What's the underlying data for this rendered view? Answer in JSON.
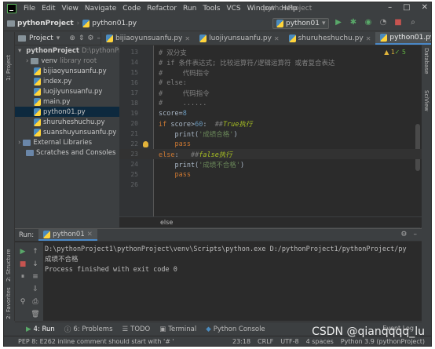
{
  "menubar": {
    "items": [
      "File",
      "Edit",
      "View",
      "Navigate",
      "Code",
      "Refactor",
      "Run",
      "Tools",
      "VCS",
      "Window",
      "Help"
    ],
    "window_title": "pythonProject"
  },
  "navbar": {
    "project": "pythonProject",
    "file": "python01.py",
    "run_config": "python01"
  },
  "tabs": {
    "project_label": "Project",
    "files": [
      {
        "label": "bijiaoyunsuanfu.py",
        "active": false
      },
      {
        "label": "luojiyunsuanfu.py",
        "active": false
      },
      {
        "label": "shuruheshuchu.py",
        "active": false
      },
      {
        "label": "python01.py",
        "active": true
      }
    ]
  },
  "sidestrips": {
    "left_top": "1: Project",
    "left_mid": "2: Structure",
    "left_bottom": "2: Favorites",
    "right_top": "Database",
    "right_bottom": "SciView"
  },
  "tree": {
    "root": "pythonProject",
    "root_path": "D:\\pythonProjec",
    "venv": "venv",
    "venv_note": "library root",
    "files": [
      "bijiaoyunsuanfu.py",
      "index.py",
      "luojiyunsuanfu.py",
      "main.py",
      "python01.py",
      "shuruheshuchu.py",
      "suanshuyunsuanfu.py"
    ],
    "external": "External Libraries",
    "scratches": "Scratches and Consoles"
  },
  "editor": {
    "line_numbers": [
      "13",
      "14",
      "15",
      "16",
      "17",
      "18",
      "19",
      "20",
      "21",
      "22",
      "23",
      "24",
      "25",
      "26"
    ],
    "warning_count": "1",
    "ok_count": "5",
    "lines": {
      "l13": "# 双分支",
      "l14": "# if 条件表达式; 比较运算符/逻辑运算符 或者复合表达",
      "l15": "#     代码指令",
      "l16": "# else:",
      "l17": "#     代码指令",
      "l18": "#     ......",
      "l19_name": "score",
      "l19_eq": "=",
      "l19_num": "8",
      "l20_kw": "if ",
      "l20_a": "score>",
      "l20_num": "60",
      "l20_b": ":  ",
      "l20_c": "##",
      "l20_todo": "True执行",
      "l21_a": "    print(",
      "l21_str": "'成绩合格'",
      "l21_b": ")",
      "l22_kw": "    pass",
      "l23_kw": "else",
      "l23_b": ":   ",
      "l23_c": "##",
      "l23_todo": "false执行",
      "l24_a": "    print(",
      "l24_str": "'成绩不合格'",
      "l24_b": ")",
      "l25_kw": "    pass"
    },
    "breadcrumb": "else"
  },
  "run": {
    "label": "Run:",
    "tab": "python01",
    "output": [
      "D:\\pythonProject1\\pythonProject\\venv\\Scripts\\python.exe D:/pythonProject1/pythonProject/py",
      "成绩不合格",
      "",
      "Process finished with exit code 0"
    ]
  },
  "bottombar": {
    "items": [
      "4: Run",
      "6: Problems",
      "TODO",
      "Terminal",
      "Python Console"
    ],
    "event_log": "Event Log"
  },
  "statusbar": {
    "message": "PEP 8: E262 inline comment should start with '# '",
    "position": "23:18",
    "line_sep": "CRLF",
    "encoding": "UTF-8",
    "indent": "4 spaces",
    "interpreter": "Python 3.9 (pythonProject)"
  },
  "watermark": "CSDN @qianqqqq_lu"
}
